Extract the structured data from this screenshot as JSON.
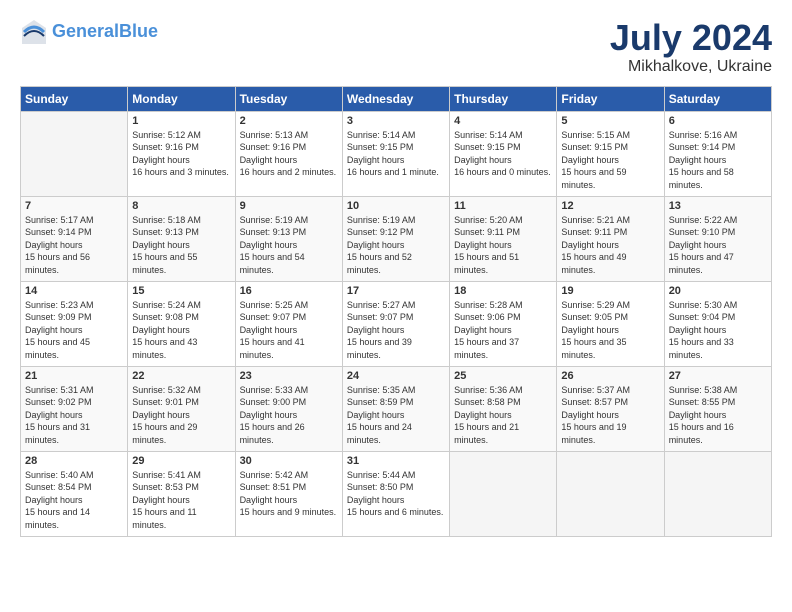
{
  "header": {
    "logo_line1": "General",
    "logo_line2": "Blue",
    "month_title": "July 2024",
    "location": "Mikhalkove, Ukraine"
  },
  "columns": [
    "Sunday",
    "Monday",
    "Tuesday",
    "Wednesday",
    "Thursday",
    "Friday",
    "Saturday"
  ],
  "weeks": [
    [
      {
        "num": "",
        "empty": true
      },
      {
        "num": "1",
        "sunrise": "5:12 AM",
        "sunset": "9:16 PM",
        "daylight": "16 hours and 3 minutes."
      },
      {
        "num": "2",
        "sunrise": "5:13 AM",
        "sunset": "9:16 PM",
        "daylight": "16 hours and 2 minutes."
      },
      {
        "num": "3",
        "sunrise": "5:14 AM",
        "sunset": "9:15 PM",
        "daylight": "16 hours and 1 minute."
      },
      {
        "num": "4",
        "sunrise": "5:14 AM",
        "sunset": "9:15 PM",
        "daylight": "16 hours and 0 minutes."
      },
      {
        "num": "5",
        "sunrise": "5:15 AM",
        "sunset": "9:15 PM",
        "daylight": "15 hours and 59 minutes."
      },
      {
        "num": "6",
        "sunrise": "5:16 AM",
        "sunset": "9:14 PM",
        "daylight": "15 hours and 58 minutes."
      }
    ],
    [
      {
        "num": "7",
        "sunrise": "5:17 AM",
        "sunset": "9:14 PM",
        "daylight": "15 hours and 56 minutes."
      },
      {
        "num": "8",
        "sunrise": "5:18 AM",
        "sunset": "9:13 PM",
        "daylight": "15 hours and 55 minutes."
      },
      {
        "num": "9",
        "sunrise": "5:19 AM",
        "sunset": "9:13 PM",
        "daylight": "15 hours and 54 minutes."
      },
      {
        "num": "10",
        "sunrise": "5:19 AM",
        "sunset": "9:12 PM",
        "daylight": "15 hours and 52 minutes."
      },
      {
        "num": "11",
        "sunrise": "5:20 AM",
        "sunset": "9:11 PM",
        "daylight": "15 hours and 51 minutes."
      },
      {
        "num": "12",
        "sunrise": "5:21 AM",
        "sunset": "9:11 PM",
        "daylight": "15 hours and 49 minutes."
      },
      {
        "num": "13",
        "sunrise": "5:22 AM",
        "sunset": "9:10 PM",
        "daylight": "15 hours and 47 minutes."
      }
    ],
    [
      {
        "num": "14",
        "sunrise": "5:23 AM",
        "sunset": "9:09 PM",
        "daylight": "15 hours and 45 minutes."
      },
      {
        "num": "15",
        "sunrise": "5:24 AM",
        "sunset": "9:08 PM",
        "daylight": "15 hours and 43 minutes."
      },
      {
        "num": "16",
        "sunrise": "5:25 AM",
        "sunset": "9:07 PM",
        "daylight": "15 hours and 41 minutes."
      },
      {
        "num": "17",
        "sunrise": "5:27 AM",
        "sunset": "9:07 PM",
        "daylight": "15 hours and 39 minutes."
      },
      {
        "num": "18",
        "sunrise": "5:28 AM",
        "sunset": "9:06 PM",
        "daylight": "15 hours and 37 minutes."
      },
      {
        "num": "19",
        "sunrise": "5:29 AM",
        "sunset": "9:05 PM",
        "daylight": "15 hours and 35 minutes."
      },
      {
        "num": "20",
        "sunrise": "5:30 AM",
        "sunset": "9:04 PM",
        "daylight": "15 hours and 33 minutes."
      }
    ],
    [
      {
        "num": "21",
        "sunrise": "5:31 AM",
        "sunset": "9:02 PM",
        "daylight": "15 hours and 31 minutes."
      },
      {
        "num": "22",
        "sunrise": "5:32 AM",
        "sunset": "9:01 PM",
        "daylight": "15 hours and 29 minutes."
      },
      {
        "num": "23",
        "sunrise": "5:33 AM",
        "sunset": "9:00 PM",
        "daylight": "15 hours and 26 minutes."
      },
      {
        "num": "24",
        "sunrise": "5:35 AM",
        "sunset": "8:59 PM",
        "daylight": "15 hours and 24 minutes."
      },
      {
        "num": "25",
        "sunrise": "5:36 AM",
        "sunset": "8:58 PM",
        "daylight": "15 hours and 21 minutes."
      },
      {
        "num": "26",
        "sunrise": "5:37 AM",
        "sunset": "8:57 PM",
        "daylight": "15 hours and 19 minutes."
      },
      {
        "num": "27",
        "sunrise": "5:38 AM",
        "sunset": "8:55 PM",
        "daylight": "15 hours and 16 minutes."
      }
    ],
    [
      {
        "num": "28",
        "sunrise": "5:40 AM",
        "sunset": "8:54 PM",
        "daylight": "15 hours and 14 minutes."
      },
      {
        "num": "29",
        "sunrise": "5:41 AM",
        "sunset": "8:53 PM",
        "daylight": "15 hours and 11 minutes."
      },
      {
        "num": "30",
        "sunrise": "5:42 AM",
        "sunset": "8:51 PM",
        "daylight": "15 hours and 9 minutes."
      },
      {
        "num": "31",
        "sunrise": "5:44 AM",
        "sunset": "8:50 PM",
        "daylight": "15 hours and 6 minutes."
      },
      {
        "num": "",
        "empty": true
      },
      {
        "num": "",
        "empty": true
      },
      {
        "num": "",
        "empty": true
      }
    ]
  ]
}
